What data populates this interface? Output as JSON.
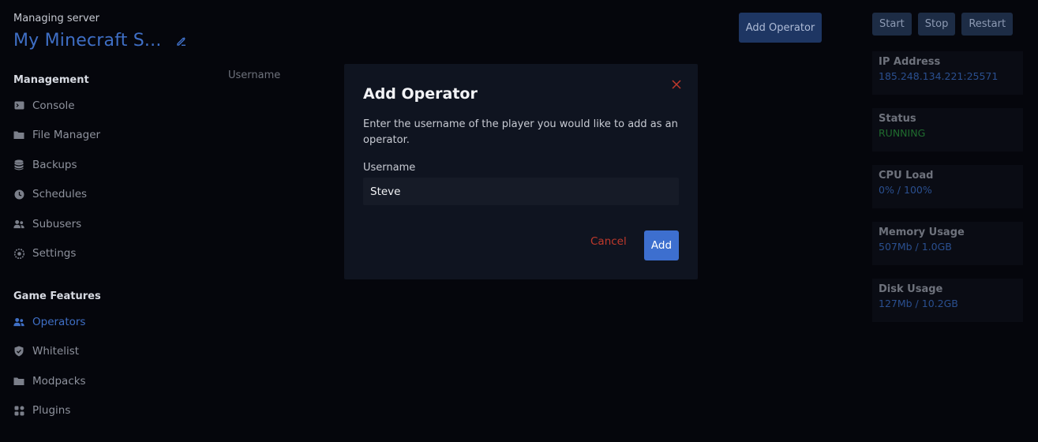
{
  "header": {
    "managing_label": "Managing server",
    "server_name": "My Minecraft S..."
  },
  "sidebar": {
    "management_title": "Management",
    "management_items": [
      {
        "label": "Console",
        "icon": "terminal-icon"
      },
      {
        "label": "File Manager",
        "icon": "folder-icon"
      },
      {
        "label": "Backups",
        "icon": "database-icon"
      },
      {
        "label": "Schedules",
        "icon": "clock-icon"
      },
      {
        "label": "Subusers",
        "icon": "users-icon"
      },
      {
        "label": "Settings",
        "icon": "gear-icon"
      }
    ],
    "features_title": "Game Features",
    "feature_items": [
      {
        "label": "Operators",
        "icon": "users-icon",
        "active": true
      },
      {
        "label": "Whitelist",
        "icon": "shield-icon"
      },
      {
        "label": "Modpacks",
        "icon": "folder-icon"
      },
      {
        "label": "Plugins",
        "icon": "puzzle-icon"
      }
    ]
  },
  "main": {
    "column_header": "Username",
    "add_operator_label": "Add Operator"
  },
  "controls": {
    "start_label": "Start",
    "stop_label": "Stop",
    "restart_label": "Restart"
  },
  "stats": [
    {
      "label": "IP Address",
      "value": "185.248.134.221:25571"
    },
    {
      "label": "Status",
      "value": "RUNNING"
    },
    {
      "label": "CPU Load",
      "value": "0% / 100%"
    },
    {
      "label": "Memory Usage",
      "value": "507Mb / 1.0GB"
    },
    {
      "label": "Disk Usage",
      "value": "127Mb / 10.2GB"
    }
  ],
  "modal": {
    "title": "Add Operator",
    "description": "Enter the username of the player you would like to add as an operator.",
    "field_label": "Username",
    "field_value": "Steve",
    "cancel_label": "Cancel",
    "add_label": "Add"
  },
  "colors": {
    "background": "#05060c",
    "accent": "#3d6fcf",
    "danger": "#c0392b",
    "running": "#1f6b2e",
    "modal_bg": "#0f1420"
  }
}
